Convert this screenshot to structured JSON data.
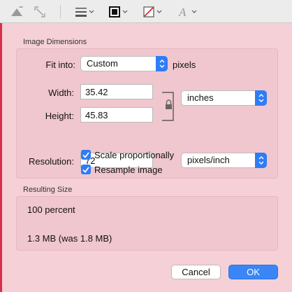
{
  "toolbar": {
    "icons": [
      "instant-alpha-icon",
      "crop-icon",
      "line-style-icon",
      "border-color-icon",
      "fill-color-icon",
      "text-style-icon"
    ]
  },
  "dimensions": {
    "section_title": "Image Dimensions",
    "fit_into_label": "Fit into:",
    "fit_into_value": "Custom",
    "fit_into_unit": "pixels",
    "width_label": "Width:",
    "width_value": "35.42",
    "height_label": "Height:",
    "height_value": "45.83",
    "size_unit": "inches",
    "resolution_label": "Resolution:",
    "resolution_value": "72",
    "resolution_unit": "pixels/inch",
    "scale_label": "Scale proportionally",
    "scale_checked": true,
    "resample_label": "Resample image",
    "resample_checked": true
  },
  "result": {
    "section_title": "Resulting Size",
    "percent": "100 percent",
    "filesize": "1.3 MB (was 1.8 MB)"
  },
  "buttons": {
    "cancel": "Cancel",
    "ok": "OK"
  },
  "colors": {
    "accent": "#2f7cf6",
    "left_bar": "#d6304f",
    "sheet_bg": "#f5d0d6"
  }
}
